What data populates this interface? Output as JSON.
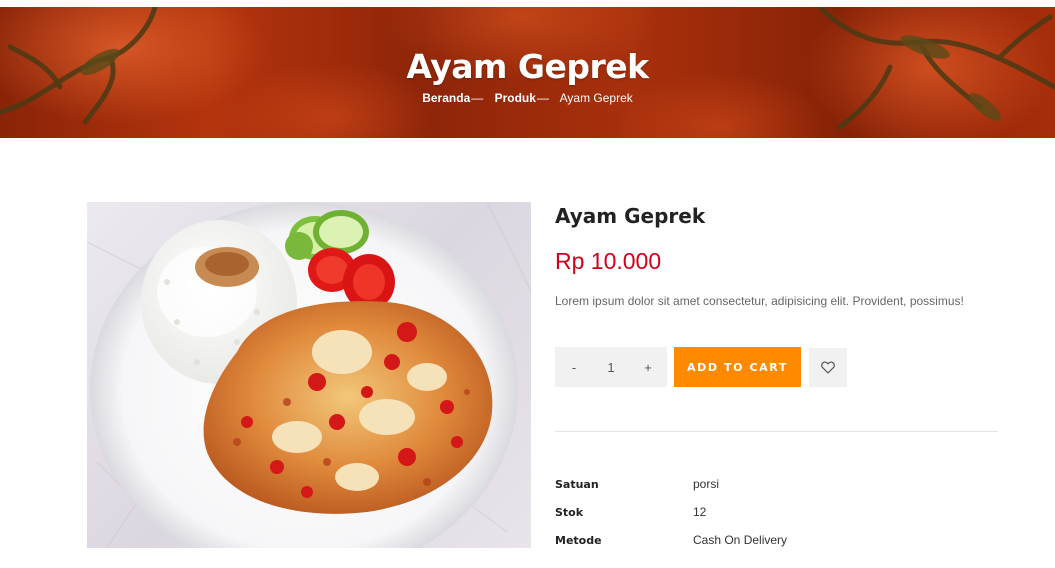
{
  "hero": {
    "title": "Ayam Geprek",
    "breadcrumb": [
      {
        "label": "Beranda",
        "separator": "—"
      },
      {
        "label": "Produk",
        "separator": "—"
      },
      {
        "label": "Ayam Geprek"
      }
    ]
  },
  "product": {
    "name": "Ayam Geprek",
    "price": "Rp 10.000",
    "description": "Lorem ipsum dolor sit amet consectetur, adipisicing elit. Provident, possimus!",
    "quantity": {
      "decrement_label": "-",
      "value": "1",
      "increment_label": "+"
    },
    "add_to_cart_label": "ADD TO CART",
    "wishlist_icon": "heart-icon",
    "specs": [
      {
        "label": "Satuan",
        "value": "porsi"
      },
      {
        "label": "Stok",
        "value": "12"
      },
      {
        "label": "Metode",
        "value": "Cash On Delivery"
      }
    ]
  },
  "colors": {
    "price": "#d0021b",
    "accent_button": "#ff8a00",
    "hero_overlay": "#a8300c"
  }
}
